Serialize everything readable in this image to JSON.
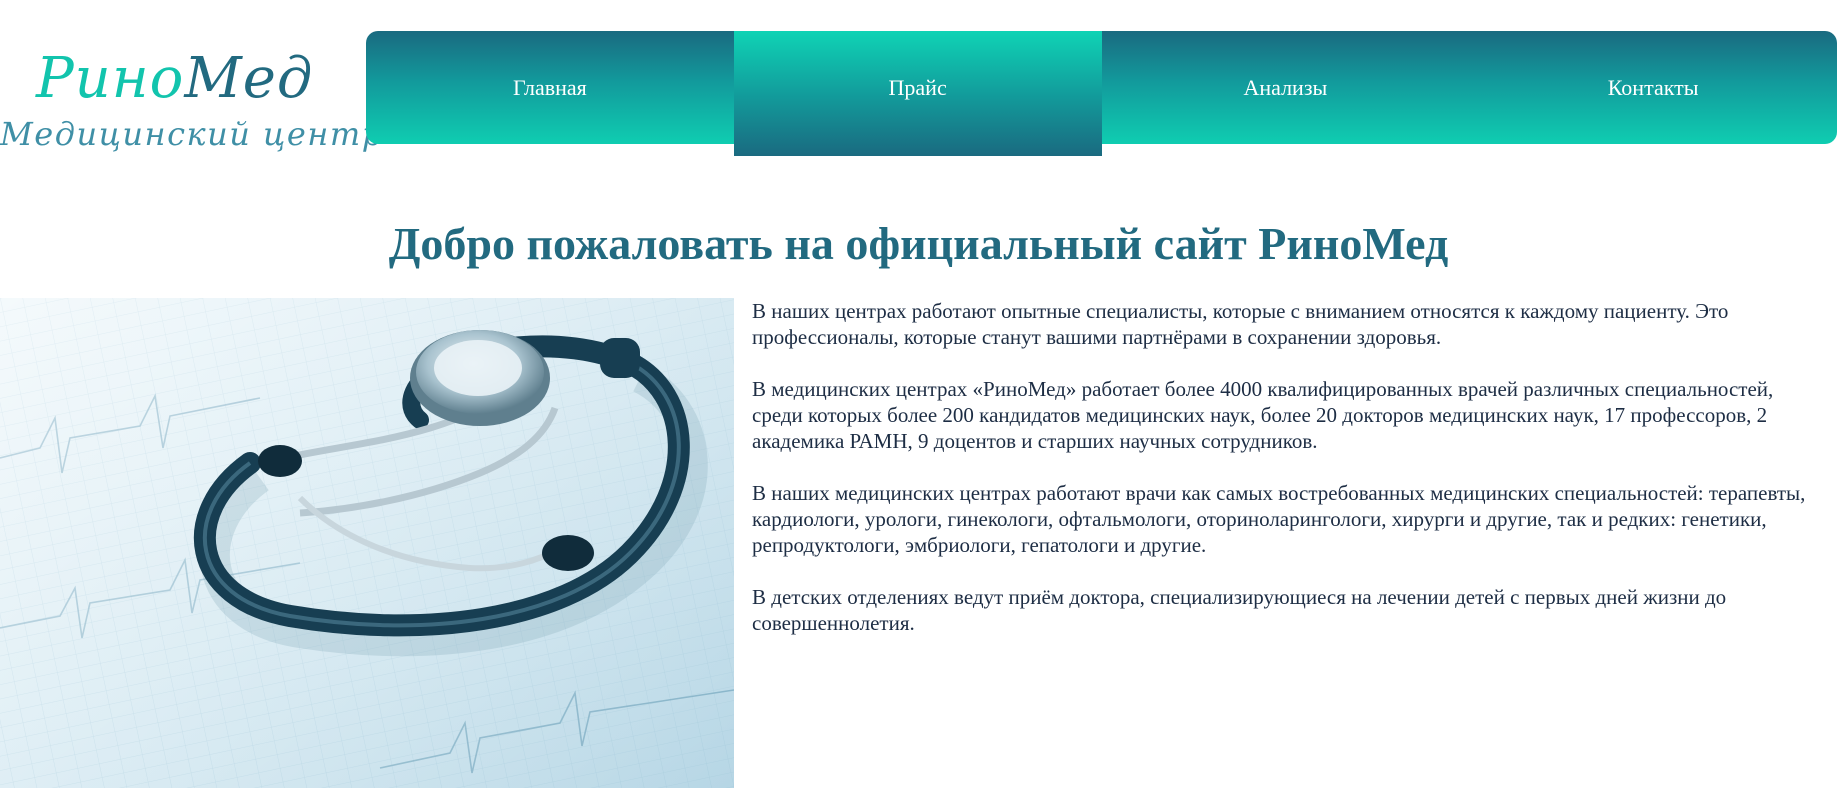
{
  "logo": {
    "brand_part1": "Рино",
    "brand_part2": "Мед",
    "tagline": "Медицинский центр"
  },
  "nav": {
    "items": [
      {
        "label": "Главная",
        "active": false
      },
      {
        "label": "Прайс",
        "active": true
      },
      {
        "label": "Анализы",
        "active": false
      },
      {
        "label": "Контакты",
        "active": false
      }
    ]
  },
  "main": {
    "heading": "Добро пожаловать на официальный сайт РиноМед",
    "paragraphs": [
      "В наших центрах работают опытные специалисты, которые с вниманием относятся к каждому пациенту. Это профессионалы, которые станут вашими партнёрами в сохранении здоровья.",
      "В медицинских центрах «РиноМед» работает более 4000 квалифицированных врачей различных специальностей, среди которых более 200 кандидатов медицинских наук, более 20 докторов медицинских наук, 17 профессоров, 2 академика РАМН, 9 доцентов и старших научных сотрудников.",
      "В наших медицинских центрах работают врачи как самых востребованных медицинских специальностей: терапевты, кардиологи, урологи, гинекологи, офтальмологи, оториноларингологи, хирурги и другие, так и редких: генетики, репродуктологи, эмбриологи, гепатологи и другие.",
      "В детских отделениях ведут приём доктора, специализирующиеся на лечении детей с первых дней жизни до совершеннолетия."
    ]
  },
  "image": {
    "subject": "stethoscope-on-ecg-chart"
  },
  "colors": {
    "brand_teal": "#12c4ad",
    "brand_dark": "#226a80",
    "heading": "#226a80",
    "text": "#1d2d44"
  }
}
